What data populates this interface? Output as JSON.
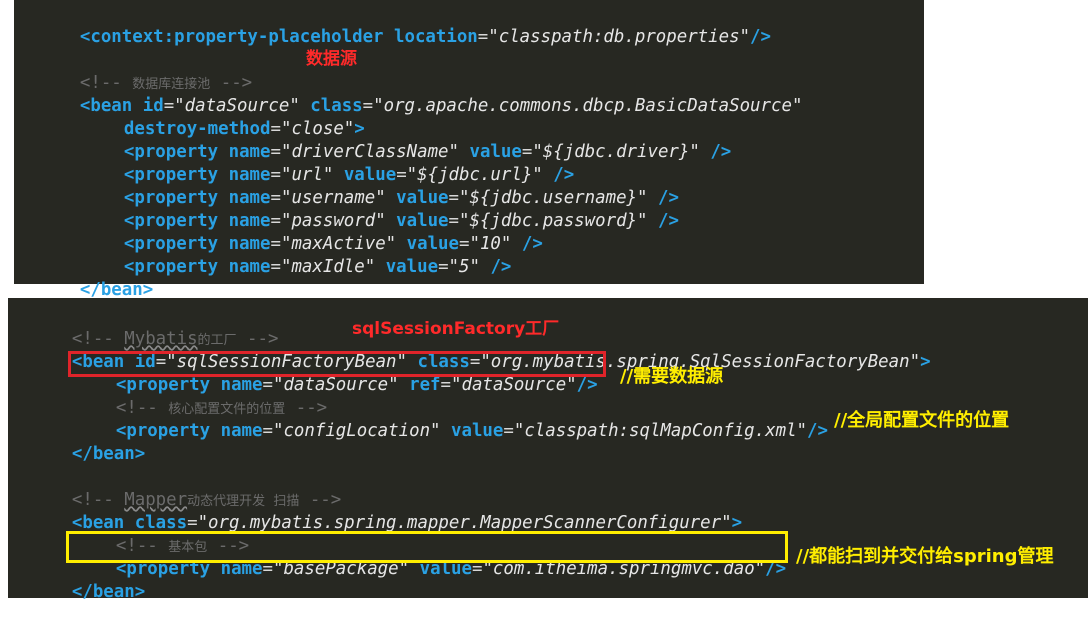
{
  "colors": {
    "panel_bg": "#272822",
    "tag": "#2aa1e4",
    "value": "#e6e6e6",
    "comment": "#6b6b6b",
    "annotation_red": "#ff2a2a",
    "annotation_yellow": "#ffee00",
    "box_red": "#e0242a",
    "box_yellow": "#ffee00"
  },
  "top": {
    "l1": {
      "tag": "<context:property-placeholder",
      "attr": "location",
      "val": "\"classpath:db.properties\"",
      "end": "/>"
    },
    "comment": {
      "open": "<!-- ",
      "text": "数据库连接池",
      "close": " -->"
    },
    "label": "数据源",
    "bean": {
      "tag": "<bean",
      "id_attr": "id",
      "id_val": "\"dataSource\"",
      "class_attr": "class",
      "class_val": "\"org.apache.commons.dbcp.BasicDataSource\""
    },
    "destroy": {
      "attr": "destroy-method",
      "val": "\"close\"",
      "end": ">"
    },
    "props": [
      {
        "tag": "<property",
        "name_attr": "name",
        "name_val": "\"driverClassName\"",
        "value_attr": "value",
        "value_val": "\"${jdbc.driver}\"",
        "end": "/>"
      },
      {
        "tag": "<property",
        "name_attr": "name",
        "name_val": "\"url\"",
        "value_attr": "value",
        "value_val": "\"${jdbc.url}\"",
        "end": "/>"
      },
      {
        "tag": "<property",
        "name_attr": "name",
        "name_val": "\"username\"",
        "value_attr": "value",
        "value_val": "\"${jdbc.username}\"",
        "end": "/>"
      },
      {
        "tag": "<property",
        "name_attr": "name",
        "name_val": "\"password\"",
        "value_attr": "value",
        "value_val": "\"${jdbc.password}\"",
        "end": "/>"
      },
      {
        "tag": "<property",
        "name_attr": "name",
        "name_val": "\"maxActive\"",
        "value_attr": "value",
        "value_val": "\"10\"",
        "end": "/>"
      },
      {
        "tag": "<property",
        "name_attr": "name",
        "name_val": "\"maxIdle\"",
        "value_attr": "value",
        "value_val": "\"5\"",
        "end": "/>"
      }
    ],
    "close": "</bean>"
  },
  "bottom": {
    "comment1": {
      "open": "<!-- ",
      "word": "Mybatis",
      "text": "的工厂",
      "close": " -->"
    },
    "label": "sqlSessionFactory工厂",
    "bean1": {
      "tag": "<bean",
      "id_attr": "id",
      "id_val": "\"sqlSessionFactoryBean\"",
      "class_attr": "class",
      "class_val": "\"org.mybatis.spring.SqlSessionFactoryBean\"",
      "end": ">"
    },
    "prop1": {
      "tag": "<property",
      "name_attr": "name",
      "name_val": "\"dataSource\"",
      "ref_attr": "ref",
      "ref_val": "\"dataSource\"",
      "end": "/>"
    },
    "note1": "//需要数据源",
    "comment2": {
      "open": "<!-- ",
      "text": "核心配置文件的位置",
      "close": " -->"
    },
    "prop2": {
      "tag": "<property",
      "name_attr": "name",
      "name_val": "\"configLocation\"",
      "value_attr": "value",
      "value_val": "\"classpath:sqlMapConfig.xml\"",
      "end": "/>"
    },
    "note2": "//全局配置文件的位置",
    "close1": "</bean>",
    "comment3": {
      "open": "<!-- ",
      "word": "Mapper",
      "text": "动态代理开发  扫描",
      "close": " -->"
    },
    "bean2": {
      "tag": "<bean",
      "class_attr": "class",
      "class_val": "\"org.mybatis.spring.mapper.MapperScannerConfigurer\"",
      "end": ">"
    },
    "comment4": {
      "open": "<!-- ",
      "text": "基本包",
      "close": " -->"
    },
    "prop3": {
      "tag": "<property",
      "name_attr": "name",
      "name_val": "\"basePackage\"",
      "value_attr": "value",
      "value_val": "\"com.itheima.springmvc.dao\"",
      "end": "/>"
    },
    "note3": "//都能扫到并交付给spring管理",
    "close2": "</bean>"
  }
}
